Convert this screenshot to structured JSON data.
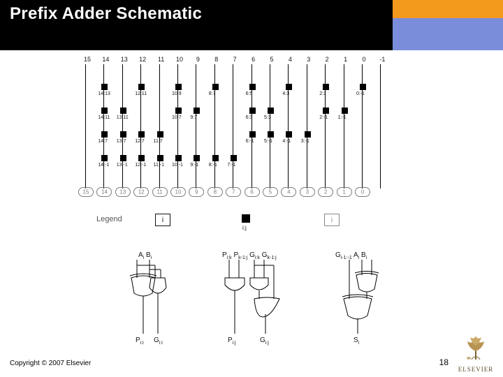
{
  "header": {
    "title": "Prefix Adder Schematic"
  },
  "copyright": "Copyright © 2007 Elsevier",
  "page_number": "18",
  "logo": {
    "brand": "ELSEVIER"
  },
  "diagram": {
    "top_labels": [
      "15",
      "14",
      "13",
      "12",
      "11",
      "10",
      "9",
      "8",
      "7",
      "6",
      "5",
      "4",
      "3",
      "2",
      "1",
      "0",
      "-1"
    ],
    "row1": [
      "14:13",
      "12:11",
      "10:9",
      "8:7",
      "6:5",
      "4:3",
      "2:1",
      "0:-1"
    ],
    "row2": [
      "14:11",
      "13:11",
      "10:7",
      "9:7",
      "6:3",
      "5:3",
      "2:-1",
      "1:-1"
    ],
    "row3": [
      "14:7",
      "13:7",
      "12:7",
      "11:7",
      "6:-1",
      "5:-1",
      "4:-1",
      "3:-1"
    ],
    "row4": [
      "14:-1",
      "13:-1",
      "12:-1",
      "11:-1",
      "10:-1",
      "9:-1",
      "8:-1",
      "7:-1"
    ],
    "bottom_labels": [
      "15",
      "14",
      "13",
      "12",
      "11",
      "10",
      "9",
      "8",
      "7",
      "6",
      "5",
      "4",
      "3",
      "2",
      "1",
      "0"
    ]
  },
  "legend": {
    "word": "Legend",
    "block_i": "i",
    "sq_label": "i:j",
    "block_i_grey": "i"
  },
  "gates": {
    "g1_in": "Ai Bi",
    "g1_out1": "Pi:i",
    "g1_out2": "Gi:i",
    "g2_in": "Pi:k Pk-1:j Gi:k Gk-1:j",
    "g2_out1": "Pi:j",
    "g2_out2": "Gi:j",
    "g3_in": "Gi-1:-1 Ai Bi",
    "g3_out": "Si"
  }
}
